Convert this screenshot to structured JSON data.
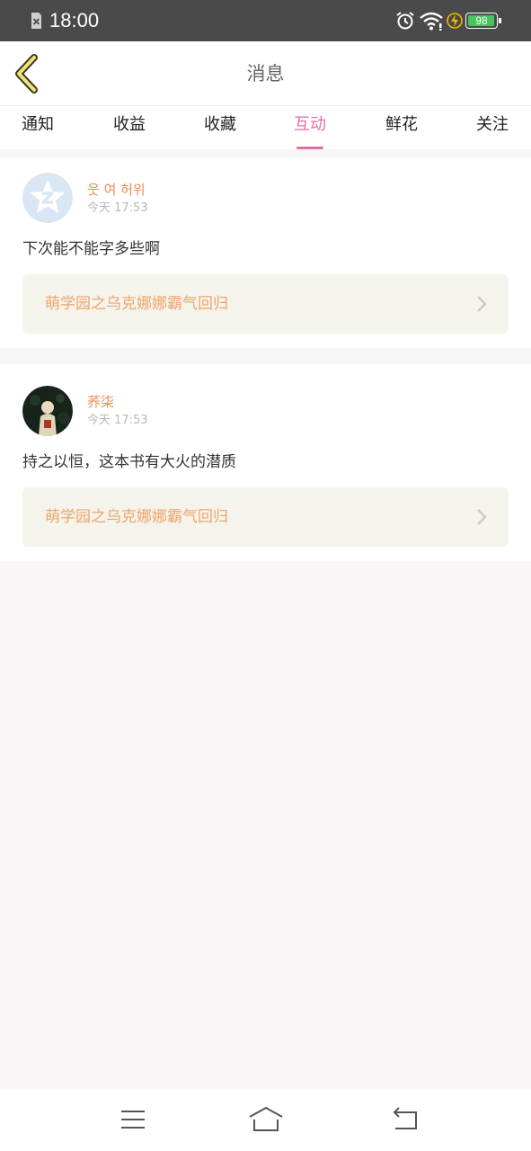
{
  "status_bar": {
    "time": "18:00",
    "battery_level": "98",
    "battery_fraction": 0.98,
    "icons": [
      "no-sim-icon",
      "alarm-icon",
      "wifi-icon",
      "charging-icon",
      "battery-icon"
    ]
  },
  "header": {
    "title": "消息",
    "back_icon": "chevron-left-icon"
  },
  "tabs": [
    {
      "label": "通知",
      "active": false
    },
    {
      "label": "收益",
      "active": false
    },
    {
      "label": "收藏",
      "active": false
    },
    {
      "label": "互动",
      "active": true
    },
    {
      "label": "鲜花",
      "active": false
    },
    {
      "label": "关注",
      "active": false
    }
  ],
  "interactions": [
    {
      "username": "웃 여 허위",
      "time": "今天 17:53",
      "comment": "下次能不能字多些啊",
      "book_title": "萌学园之乌克娜娜霸气回归",
      "avatar": "default-star-avatar"
    },
    {
      "username": "荞柒",
      "time": "今天 17:53",
      "comment": "持之以恒，这本书有大火的潜质",
      "book_title": "萌学园之乌克娜娜霸气回归",
      "avatar": "photo-avatar"
    }
  ],
  "colors": {
    "accent": "#e070a8",
    "username": "#f08a57",
    "book_title": "#f0a46a",
    "book_bg": "#f4f4ec",
    "status_bar_bg": "#4a4a4a"
  },
  "nav_bar": {
    "icons": [
      "menu-icon",
      "home-icon",
      "back-icon"
    ]
  }
}
